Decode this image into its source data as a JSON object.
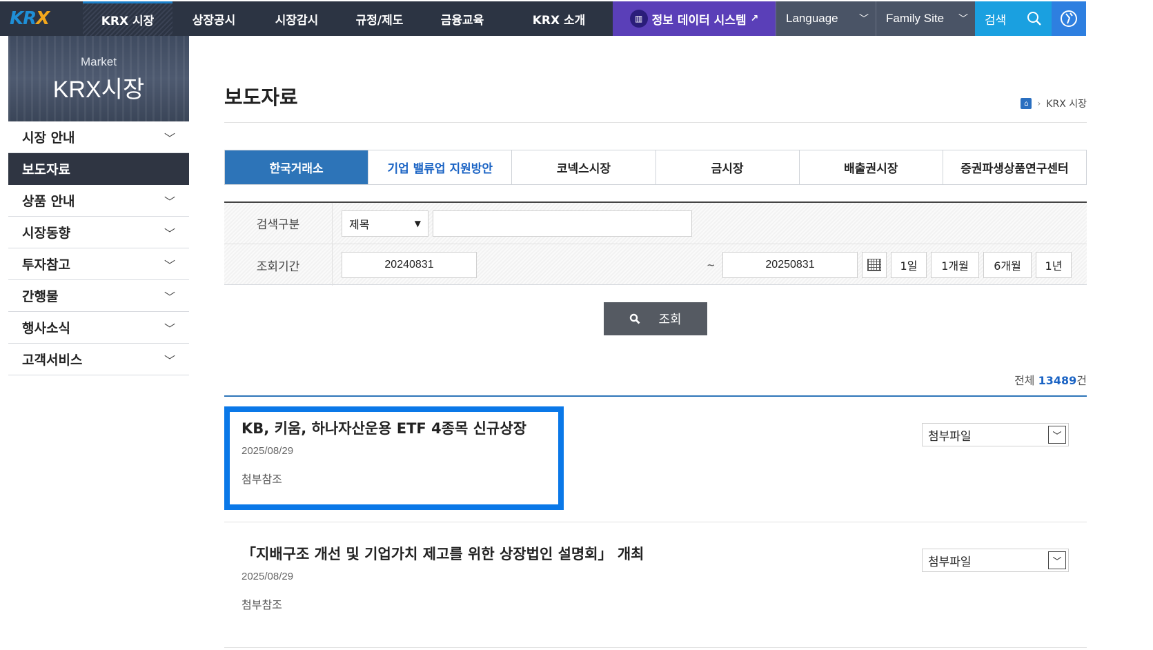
{
  "header": {
    "logo": "KRX",
    "nav": [
      {
        "label": "KRX 시장"
      },
      {
        "label": "상장공시"
      },
      {
        "label": "시장감시"
      },
      {
        "label": "규정/제도"
      },
      {
        "label": "금융교육"
      },
      {
        "label": "KRX 소개"
      }
    ],
    "data_system": "정보 데이터 시스템",
    "language": "Language",
    "family_site": "Family Site",
    "search": "검색"
  },
  "sidebar": {
    "banner_sub": "Market",
    "banner_title": "KRX시장",
    "items": [
      {
        "label": "시장 안내"
      },
      {
        "label": "보도자료"
      },
      {
        "label": "상품 안내"
      },
      {
        "label": "시장동향"
      },
      {
        "label": "투자참고"
      },
      {
        "label": "간행물"
      },
      {
        "label": "행사소식"
      },
      {
        "label": "고객서비스"
      }
    ]
  },
  "main": {
    "title": "보도자료",
    "breadcrumb": "KRX 시장",
    "tabs": [
      {
        "label": "한국거래소"
      },
      {
        "label": "기업 밸류업 지원방안"
      },
      {
        "label": "코넥스시장"
      },
      {
        "label": "금시장"
      },
      {
        "label": "배출권시장"
      },
      {
        "label": "증권파생상품연구센터"
      }
    ],
    "search": {
      "category_label": "검색구분",
      "category_value": "제목",
      "keyword_value": "",
      "period_label": "조회기간",
      "date_from": "20240831",
      "tilde": "~",
      "date_to": "20250831",
      "periods": [
        "1일",
        "1개월",
        "6개월",
        "1년"
      ],
      "query_button": "조회"
    },
    "total_prefix": "전체 ",
    "total_count": "13489",
    "total_suffix": "건",
    "items": [
      {
        "title": "KB, 키움, 하나자산운용 ETF 4종목 신규상장",
        "date": "2025/08/29",
        "desc": "첨부참조",
        "attach": "첨부파일"
      },
      {
        "title": "「지배구조 개선 및 기업가치 제고를 위한 상장법인 설명회」 개최",
        "date": "2025/08/29",
        "desc": "첨부참조",
        "attach": "첨부파일"
      }
    ]
  },
  "colors": {
    "nav_bg": "#2c3443",
    "active_tab": "#2d74b8",
    "data_system": "#5a3fb8",
    "search_bg": "#1aa0e0",
    "focus_border": "#0a78e8"
  }
}
